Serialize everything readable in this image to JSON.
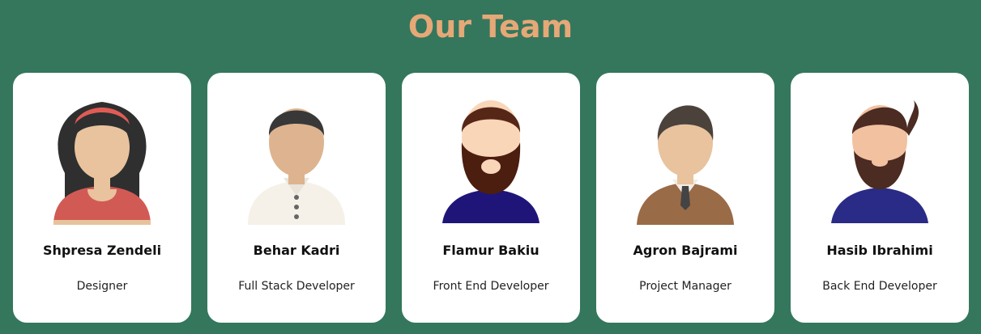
{
  "header": {
    "title": "Our Team"
  },
  "team": [
    {
      "name": "Shpresa Zendeli",
      "role": "Designer",
      "avatar_icon": "female-avatar-icon"
    },
    {
      "name": "Behar Kadri",
      "role": "Full Stack Developer",
      "avatar_icon": "male-avatar-icon"
    },
    {
      "name": "Flamur Bakiu",
      "role": "Front End Developer",
      "avatar_icon": "bearded-male-avatar-icon"
    },
    {
      "name": "Agron Bajrami",
      "role": "Project Manager",
      "avatar_icon": "male-avatar-tie-icon"
    },
    {
      "name": "Hasib Ibrahimi",
      "role": "Back End Developer",
      "avatar_icon": "bearded-male-avatar-icon"
    }
  ],
  "colors": {
    "background": "#34775d",
    "title": "#e6a877",
    "card": "#ffffff"
  }
}
